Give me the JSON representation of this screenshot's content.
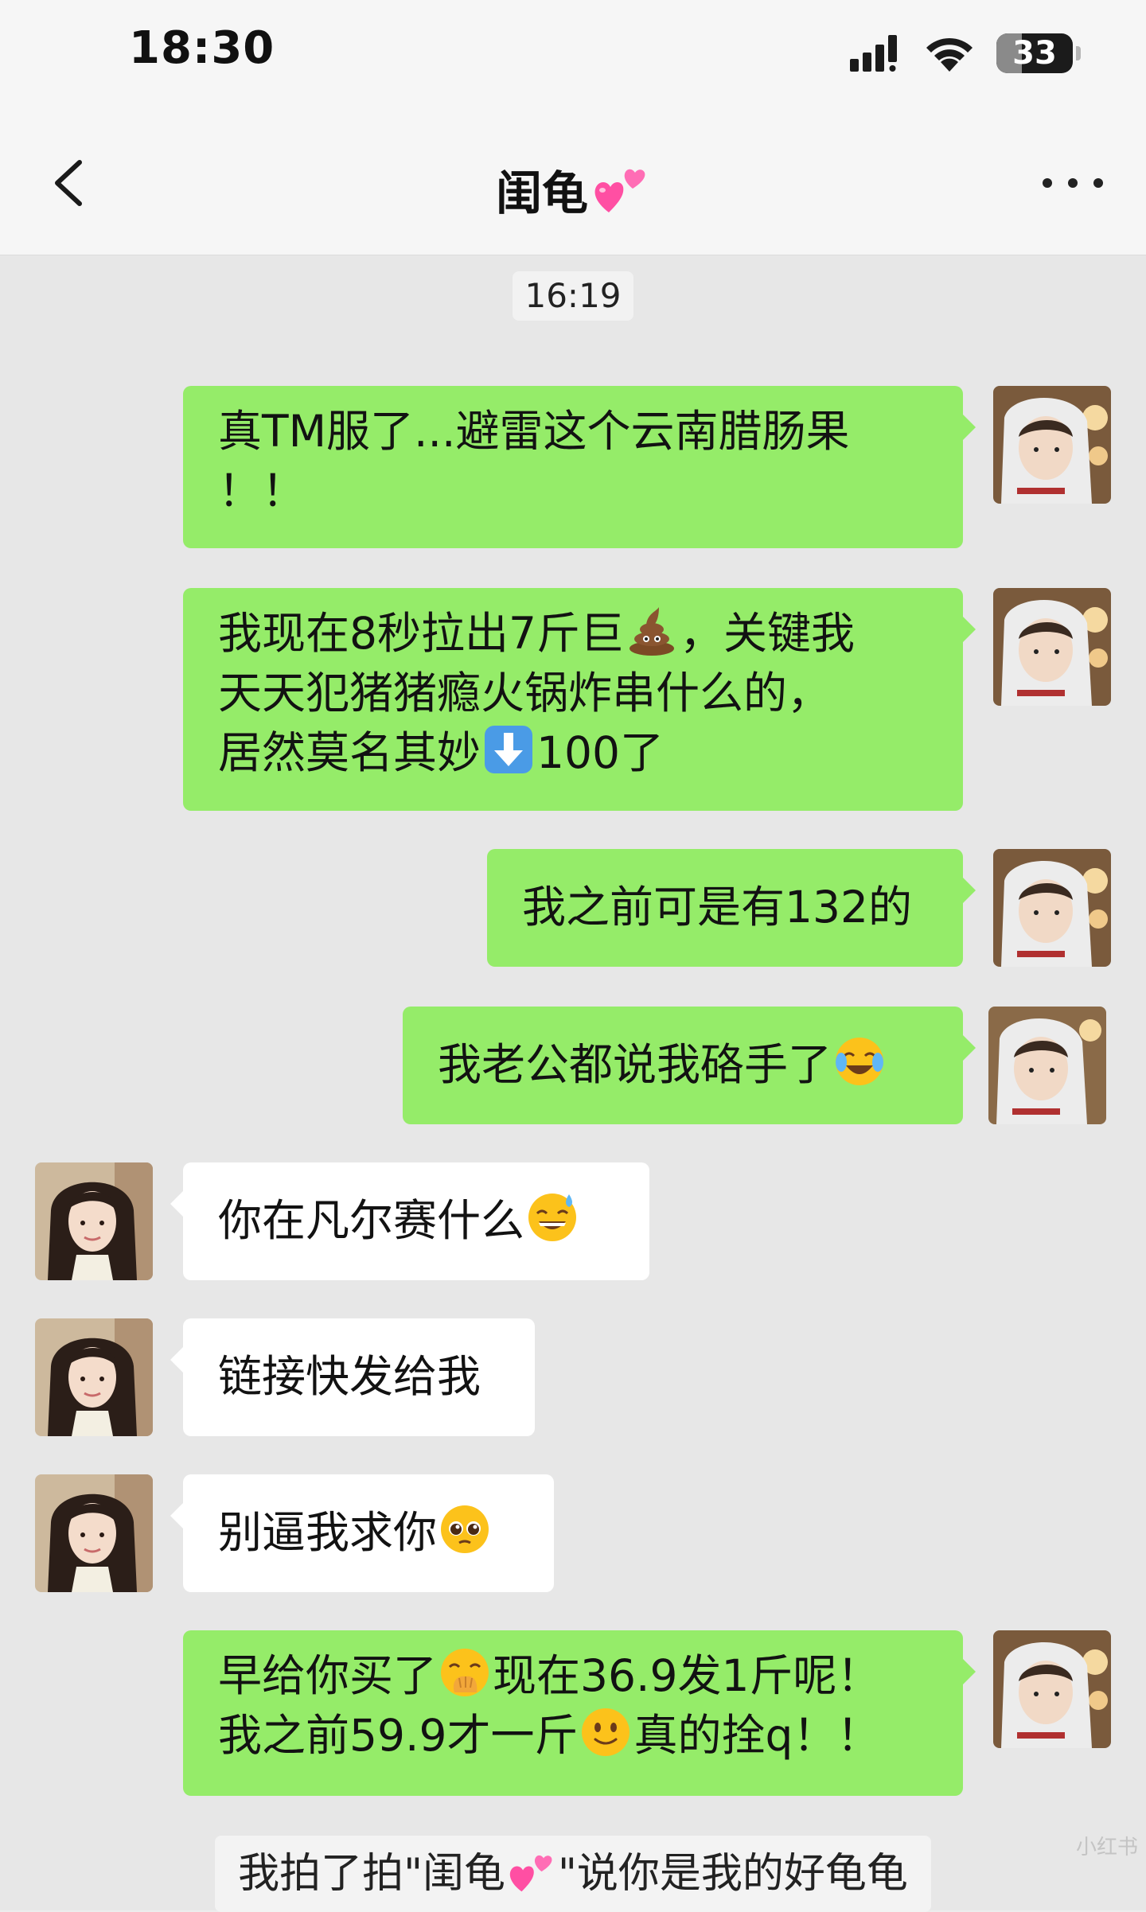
{
  "status_bar": {
    "time": "18:30",
    "battery": "33",
    "battery_level": 0.33
  },
  "nav": {
    "title": "闺龟"
  },
  "chat": {
    "timestamp": "16:19",
    "messages": [
      {
        "lines": [
          "真TM服了...避雷这个云南腊肠果",
          "！！"
        ]
      },
      {
        "lines": [
          "我现在8秒拉出7斤巨",
          "，关键我",
          "天天犯猪猪瘾火锅炸串什么的，",
          "居然莫名其妙",
          "100了"
        ]
      },
      {
        "lines": [
          "我之前可是有132的"
        ]
      },
      {
        "lines": [
          "我老公都说我硌手了"
        ]
      },
      {
        "lines": [
          "你在凡尔赛什么"
        ]
      },
      {
        "lines": [
          "链接快发给我"
        ]
      },
      {
        "lines": [
          "别逼我求你"
        ]
      },
      {
        "lines": [
          "早给你买了",
          "现在36.9发1斤呢！",
          "我之前59.9才一斤",
          "真的拴q！！"
        ]
      }
    ],
    "pat_notice": {
      "prefix": "我拍了拍\"闺龟",
      "suffix": "\"说你是我的好龟龟"
    },
    "watermark": "小红书"
  },
  "icons": {
    "back": "chevron-left-icon",
    "more": "more-dots-icon",
    "title_emoji": "two-hearts-icon",
    "poop": "poop-emoji",
    "down_arrow": "down-arrow-emoji",
    "tears_of_joy": "loudly-crying-laughing-emoji",
    "sweat_smile": "sweat-smile-emoji",
    "pleading": "pleading-face-emoji",
    "hand_over_mouth": "hand-over-mouth-emoji",
    "slight_smile": "slightly-smiling-emoji"
  },
  "colors": {
    "mine_bubble": "#95ec69",
    "their_bubble": "#ffffff",
    "chat_background": "#e7e7e7",
    "bar_background": "#f6f6f6"
  }
}
